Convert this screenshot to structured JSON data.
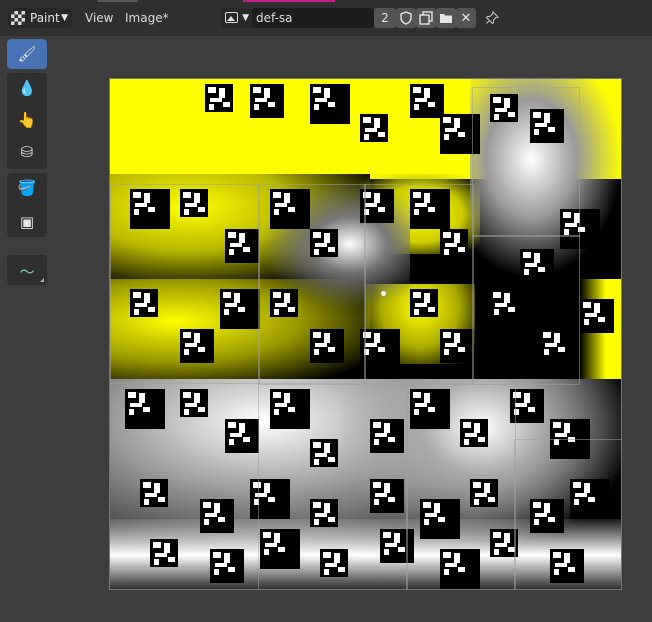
{
  "header": {
    "mode_label": "Paint",
    "menu_view": "View",
    "menu_image": "Image*",
    "image_name": "def-sa",
    "image_users": "2"
  },
  "icons": {
    "mode": "checker-paint-icon",
    "image_type": "image-icon",
    "fake_user": "shield-icon",
    "new_image": "duplicate-icon",
    "open_image": "folder-icon",
    "unlink": "close-icon",
    "pin": "pin-icon"
  },
  "toolbar": {
    "tools": [
      "draw",
      "soften",
      "smear",
      "clone",
      "fill",
      "mask",
      "annotate"
    ],
    "active": "draw",
    "glyphs": {
      "draw": "🖌",
      "soften": "💧",
      "smear": "👆",
      "clone": "⛁",
      "fill": "🪣",
      "mask": "▣",
      "annotate": "〜"
    }
  },
  "colors": {
    "header_bg": "#303030",
    "editor_bg": "#3d3d3d",
    "active_tool": "#4772b3",
    "paint_yellow": "#ffff00",
    "accent_strip_magenta": "#c41e8b"
  }
}
